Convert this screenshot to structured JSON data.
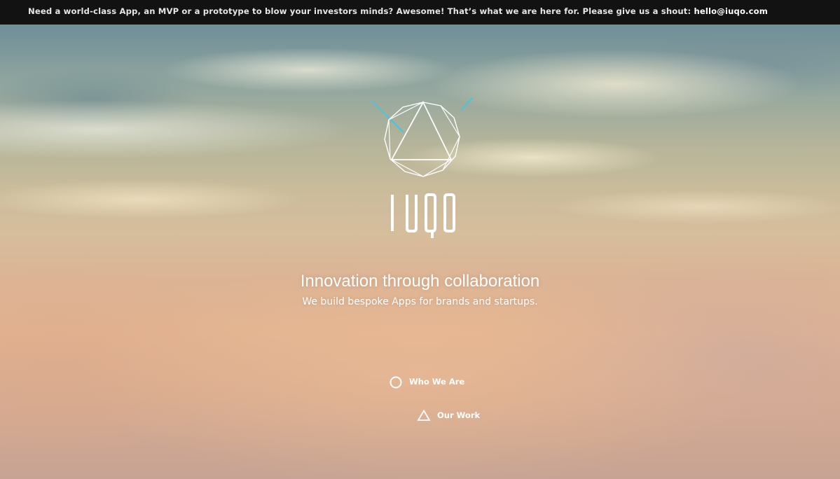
{
  "topbar": {
    "message": "Need a world-class App, an MVP or a prototype to blow your investors minds? Awesome! That’s what we are here for. Please give us a shout: ",
    "email": "hello@iuqo.com"
  },
  "logo": {
    "wordmark": "IUQO",
    "accent_color": "#4fc3d9"
  },
  "hero": {
    "headline": "Innovation through collaboration",
    "subline": "We build bespoke Apps for brands and startups."
  },
  "nav": [
    {
      "label": "Who We Are",
      "icon": "circle-icon"
    },
    {
      "label": "Our Work",
      "icon": "triangle-icon"
    }
  ],
  "colors": {
    "topbar_bg": "#121212",
    "text": "#ffffff"
  }
}
